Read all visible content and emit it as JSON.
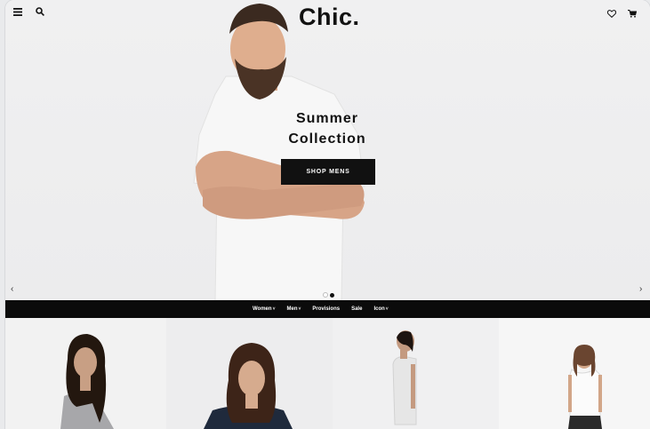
{
  "header": {
    "logo": "Chic.",
    "icons": [
      "menu-icon",
      "search-icon",
      "heart-icon",
      "cart-icon"
    ]
  },
  "hero": {
    "title_line1": "Summer",
    "title_line2": "Collection",
    "cta_label": "SHOP MENS",
    "slides": 2,
    "active_slide": 1
  },
  "nav": {
    "items": [
      {
        "label": "Women",
        "has_dropdown": true
      },
      {
        "label": "Men",
        "has_dropdown": true
      },
      {
        "label": "Provisions",
        "has_dropdown": false
      },
      {
        "label": "Sale",
        "has_dropdown": false
      },
      {
        "label": "Icon",
        "has_dropdown": true
      }
    ]
  },
  "colors": {
    "accent": "#111111",
    "nav_bg": "#0b0b0b",
    "hero_bg": "#eeeeef"
  }
}
